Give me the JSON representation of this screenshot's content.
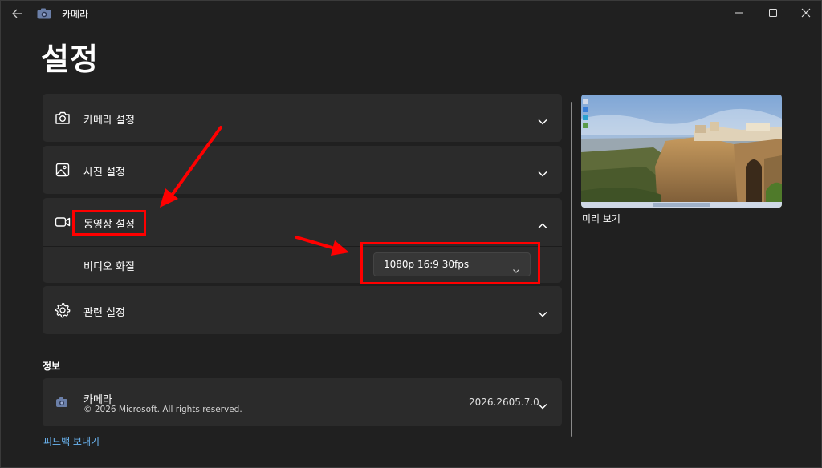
{
  "window": {
    "app_title": "카메라",
    "buttons": {
      "back": "back-arrow-icon",
      "minimize": "minimize-icon",
      "maximize": "maximize-icon",
      "close": "close-icon"
    }
  },
  "page": {
    "title": "설정"
  },
  "settings": {
    "camera": {
      "label": "카메라 설정",
      "icon": "camera-icon"
    },
    "photo": {
      "label": "사진 설정",
      "icon": "image-icon"
    },
    "video": {
      "label": "동영상 설정",
      "icon": "video-camera-icon",
      "quality": {
        "label": "비디오 화질",
        "value": "1080p 16:9 30fps"
      }
    },
    "related": {
      "label": "관련 설정",
      "icon": "gear-icon"
    }
  },
  "info": {
    "section_title": "정보",
    "app_name": "카메라",
    "copyright": "© 2026 Microsoft. All rights reserved.",
    "version": "2026.2605.7.0"
  },
  "feedback": {
    "label": "피드백 보내기"
  },
  "preview": {
    "label": "미리 보기"
  },
  "colors": {
    "background": "#202020",
    "card": "#2b2b2b",
    "link": "#6cb8f6",
    "annotation": "#ff0000"
  }
}
